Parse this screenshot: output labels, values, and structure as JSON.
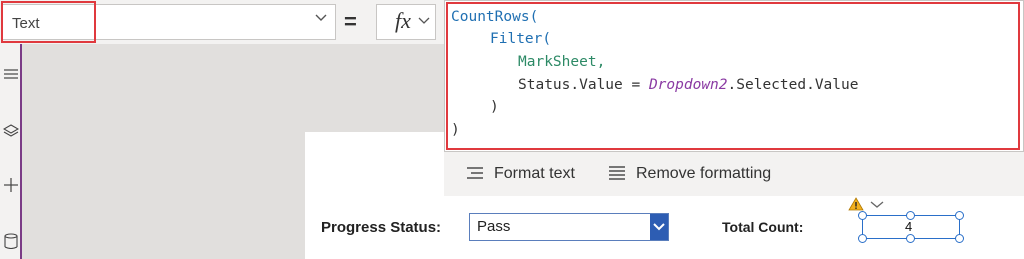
{
  "formula_bar": {
    "property": "Text",
    "equals": "=",
    "fx": "fx"
  },
  "editor": {
    "line1": "CountRows(",
    "line2_fn": "Filter(",
    "line3_src": "MarkSheet,",
    "line4_a": "Status.Value = ",
    "line4_ctrl": "Dropdown2",
    "line4_b": ".Selected.Value",
    "line5": ")",
    "line6": ")"
  },
  "format_toolbar": {
    "format_text": "Format text",
    "remove_formatting": "Remove formatting"
  },
  "form": {
    "progress_label": "Progress Status:",
    "dropdown_value": "Pass",
    "total_label": "Total Count:",
    "total_value": "4"
  },
  "left_rail": {
    "icons": [
      "hamburger-icon",
      "layers-icon",
      "plus-icon",
      "database-icon"
    ]
  },
  "colors": {
    "highlight": "#e0393e",
    "dropdown_accent": "#2d5db3",
    "rail_accent": "#7a3b86"
  }
}
